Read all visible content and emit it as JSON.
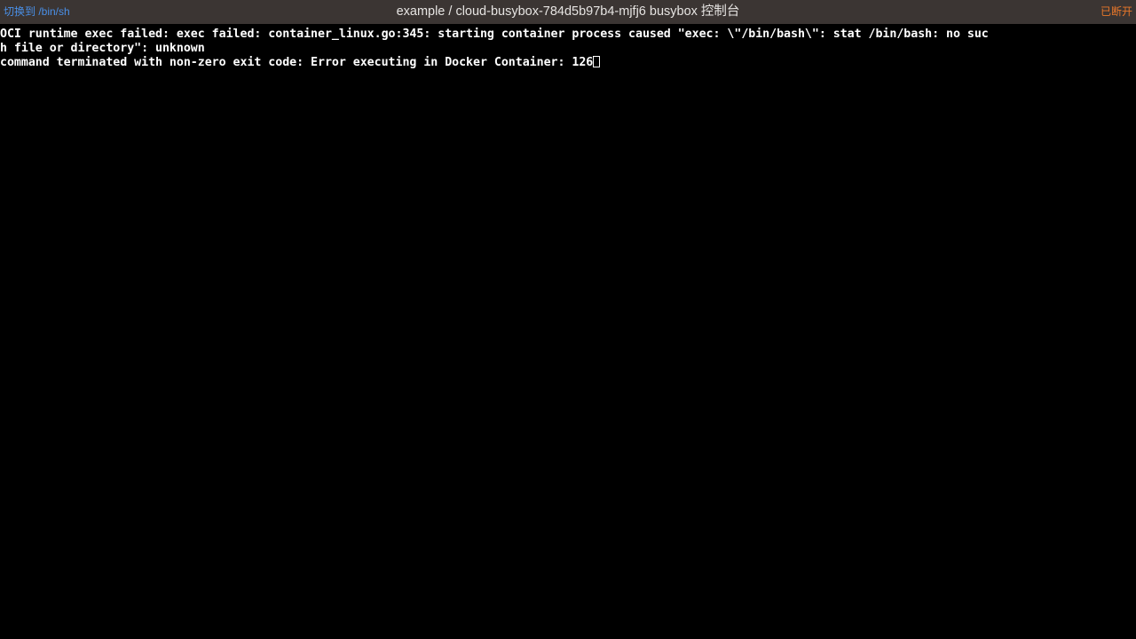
{
  "window": {
    "title": "example / cloud-busybox-784d5b97b4-mjfj6 busybox 控制台",
    "background_color": "#000000",
    "topbar_color": "#3b3533"
  },
  "topbar": {
    "switch_shell_label": "切换到 /bin/sh",
    "switch_shell_color": "#4a90e8",
    "title": "example / cloud-busybox-784d5b97b4-mjfj6 busybox 控制台",
    "title_color": "#e6e4e2",
    "status_label": "已断开",
    "status_color": "#e8772a"
  },
  "terminal": {
    "foreground_color": "#ffffff",
    "background_color": "#000000",
    "lines": [
      "OCI runtime exec failed: exec failed: container_linux.go:345: starting container process caused \"exec: \\\"/bin/bash\\\": stat /bin/bash: no suc",
      "h file or directory\": unknown",
      "command terminated with non-zero exit code: Error executing in Docker Container: 126"
    ],
    "cursor": {
      "style": "hollow-block",
      "after_line_index": 2
    }
  }
}
